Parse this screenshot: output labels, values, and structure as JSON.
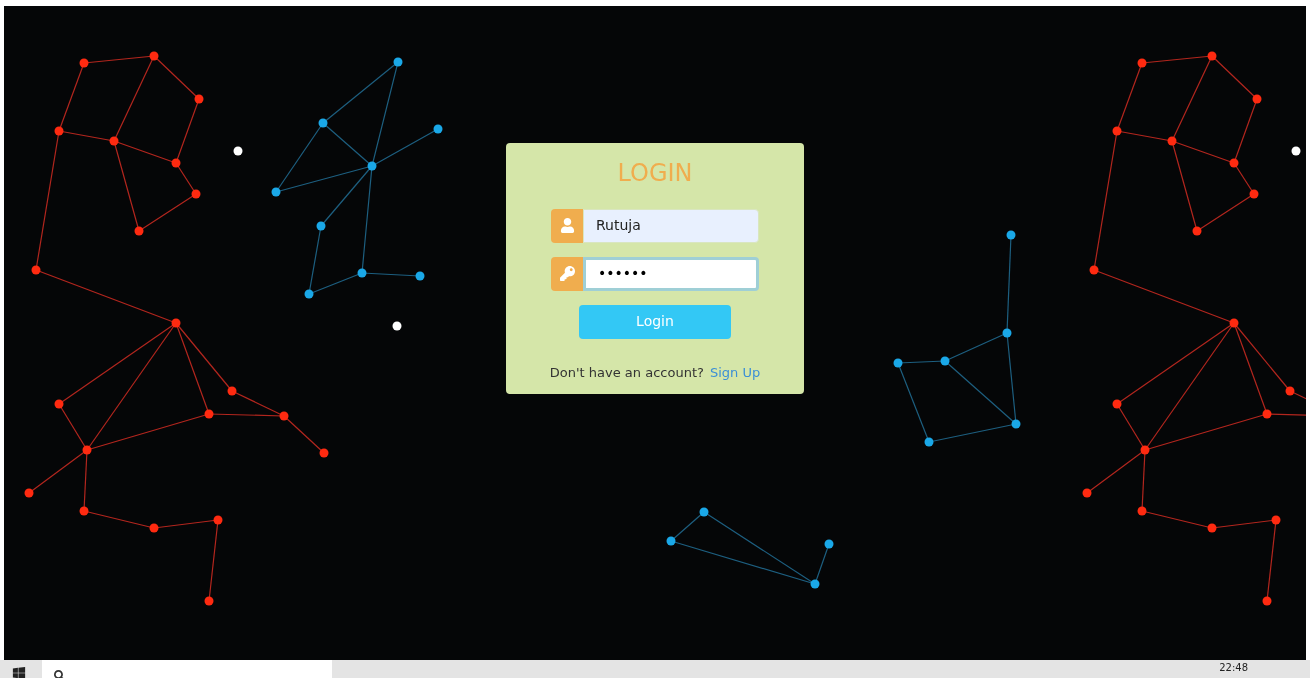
{
  "login_card": {
    "title": "LOGIN",
    "fields": [
      {
        "kind": "user",
        "value": "Rutuja",
        "focused": false
      },
      {
        "kind": "password",
        "value": "••••••",
        "focused": true
      }
    ],
    "button": "Login",
    "prompt": "Don't have an account?",
    "link": "Sign Up"
  },
  "taskbar": {
    "clock": "22:48"
  }
}
